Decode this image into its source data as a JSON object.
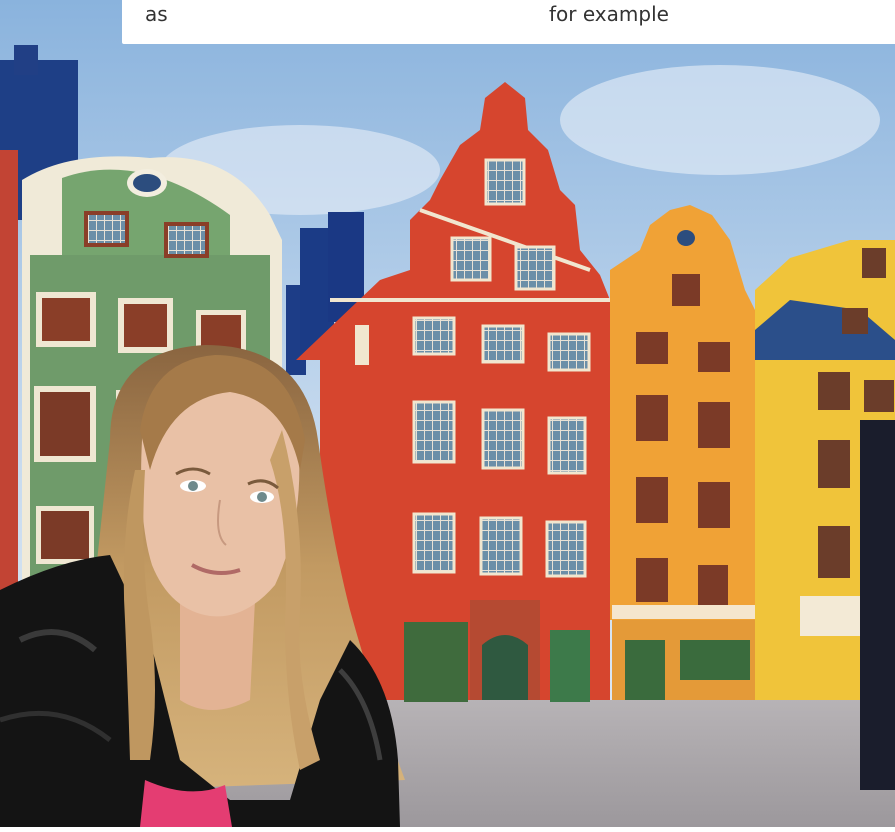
{
  "caption": {
    "left_text": "as",
    "right_text": "for example"
  },
  "photo": {
    "subject": "girl-portrait",
    "background": "colorful-gabled-buildings-on-cobblestone-square",
    "colors": {
      "sky": "#a9c6e6",
      "green_house": "#6f9b6a",
      "red_house": "#d6452e",
      "orange_house": "#f0a236",
      "yellow_house": "#f0c43a",
      "cobblestone": "#a9a6a8",
      "jacket": "#141414",
      "hair": "#b48a55",
      "skin": "#e9c1a6",
      "shirt_pink": "#e43d72"
    }
  }
}
